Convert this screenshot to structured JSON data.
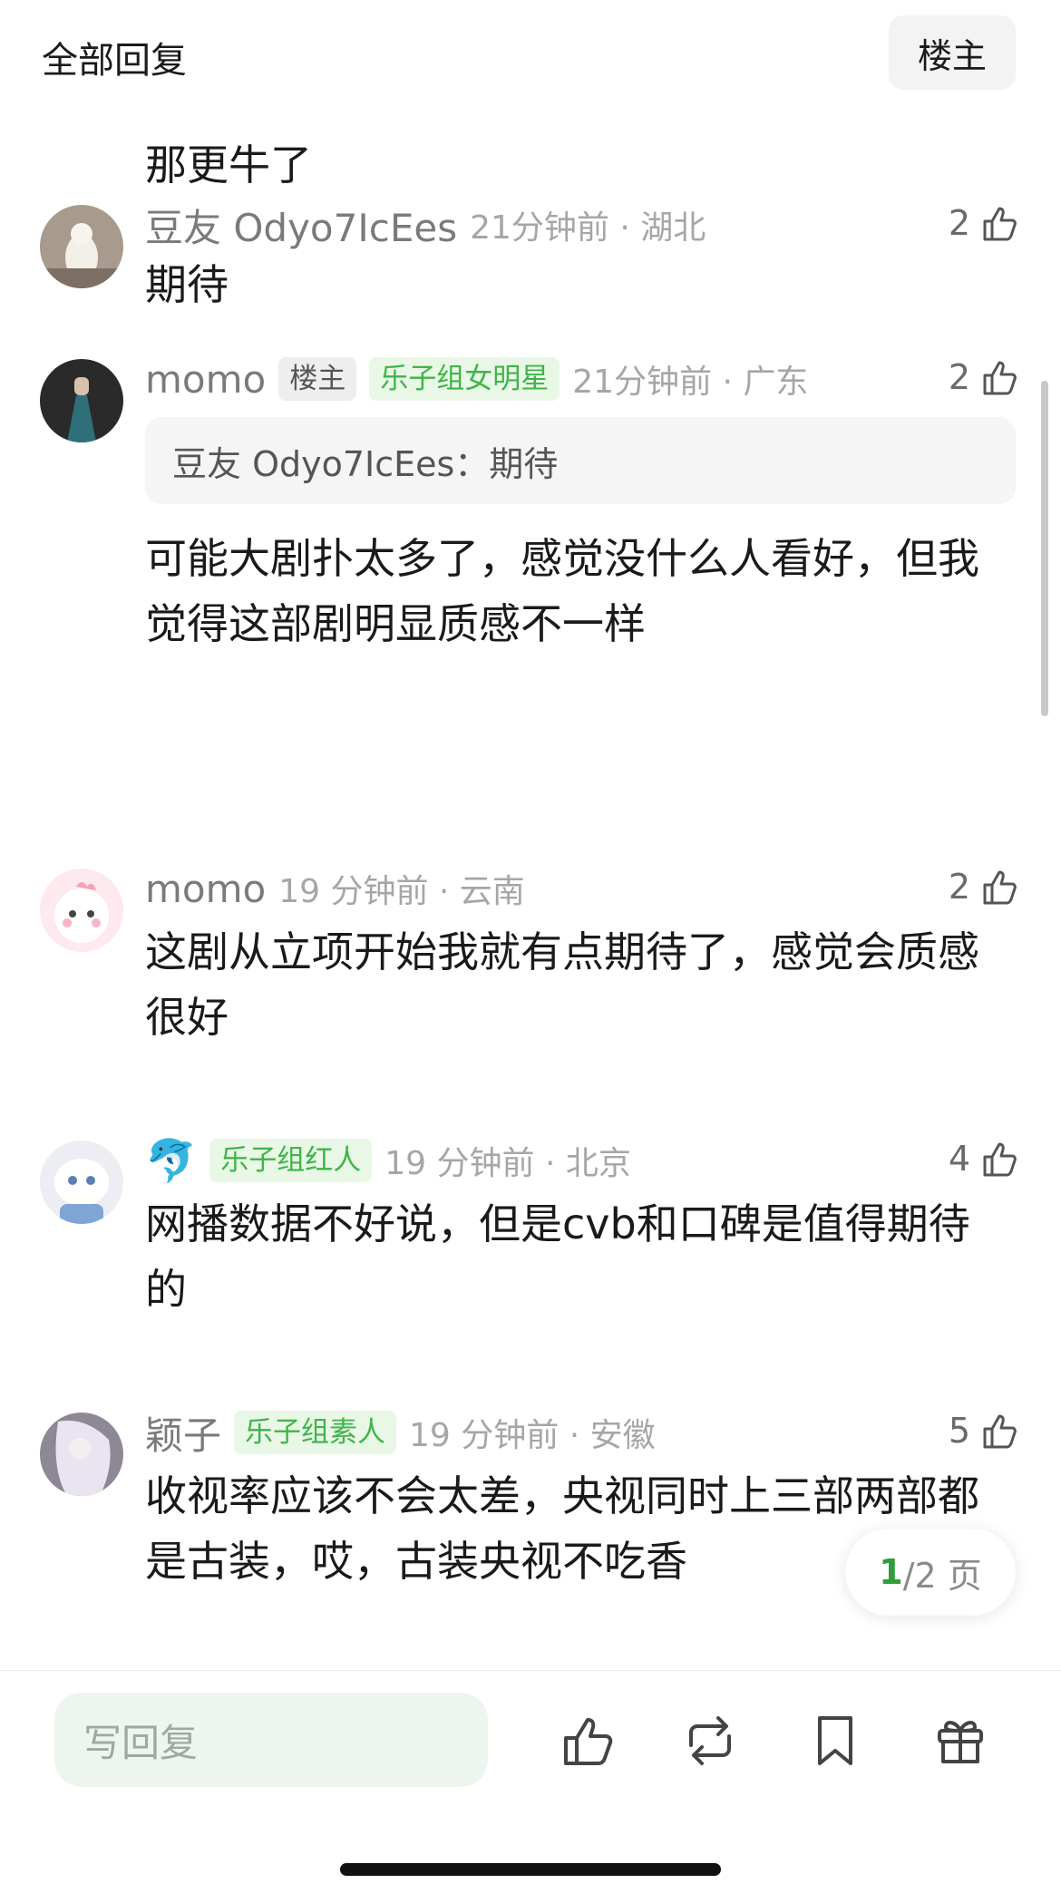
{
  "header": {
    "title": "全部回复",
    "op_filter_label": "楼主"
  },
  "partial_comment": {
    "text": "那更牛了"
  },
  "comments": [
    {
      "name": "豆友 Odyo7IcEes",
      "tags": [],
      "time": "21分钟前 · 湖北",
      "likes": "2",
      "text": "期待"
    },
    {
      "name": "momo",
      "tags": [
        {
          "label": "楼主",
          "style": "op"
        },
        {
          "label": "乐子组女明星",
          "style": "green"
        }
      ],
      "time": "21分钟前 · 广东",
      "likes": "2",
      "quote": "豆友 Odyo7IcEes：期待",
      "text": "可能大剧扑太多了，感觉没什么人看好，但我觉得这部剧明显质感不一样"
    },
    {
      "name": "momo",
      "tags": [],
      "time": "19 分钟前 · 云南",
      "likes": "2",
      "text": "这剧从立项开始我就有点期待了，感觉会质感很好"
    },
    {
      "name": "🐬",
      "tags": [
        {
          "label": "乐子组红人",
          "style": "green"
        }
      ],
      "time": "19 分钟前 · 北京",
      "likes": "4",
      "text": "网播数据不好说，但是cvb和口碑是值得期待的"
    },
    {
      "name": "颖子",
      "tags": [
        {
          "label": "乐子组素人",
          "style": "green"
        }
      ],
      "time": "19 分钟前 · 安徽",
      "likes": "5",
      "text": "收视率应该不会太差，央视同时上三部两部都是古装，哎，古装央视不吃香"
    }
  ],
  "pager": {
    "current": "1",
    "total_suffix": "/2 页"
  },
  "bottom_bar": {
    "reply_placeholder": "写回复",
    "icons": [
      "like-icon",
      "repost-icon",
      "bookmark-icon",
      "gift-icon"
    ]
  },
  "colors": {
    "accent_green": "#3fb449",
    "green_tag_bg": "#e9f7e6",
    "reply_bg": "#eef5ee"
  }
}
